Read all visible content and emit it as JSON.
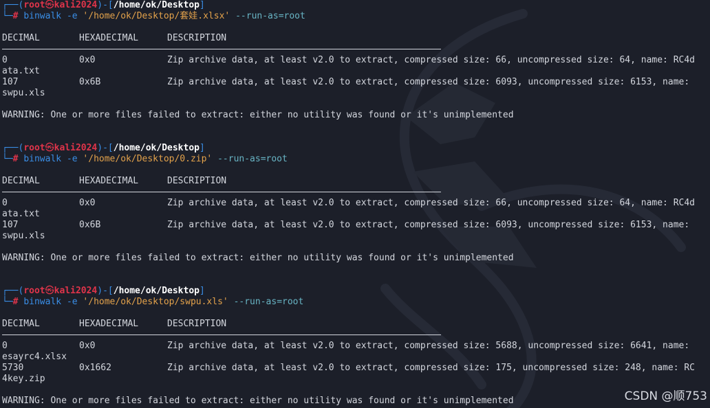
{
  "prompt_box_top": "┌──(",
  "prompt_box_mid": ")-[",
  "prompt_box_end": "]",
  "prompt_box_bottom": "└─",
  "prompt_user": "root",
  "prompt_at": "㉿",
  "prompt_host": "kali2024",
  "prompt_hash": "#",
  "blocks": [
    {
      "path": "/home/ok/Desktop",
      "cmd": "binwalk",
      "opt": "-e",
      "arg": "'/home/ok/Desktop/套娃.xlsx'",
      "flag": "--run-as=root",
      "headers": [
        "DECIMAL",
        "HEXADECIMAL",
        "DESCRIPTION"
      ],
      "rows": [
        {
          "dec": "0",
          "hex": "0x0",
          "desc": "Zip archive data, at least v2.0 to extract, compressed size: 66, uncompressed size: 64, name: RC4d",
          "wrap": "ata.txt"
        },
        {
          "dec": "107",
          "hex": "0x6B",
          "desc": "Zip archive data, at least v2.0 to extract, compressed size: 6093, uncompressed size: 6153, name:",
          "wrap": "swpu.xls"
        }
      ],
      "warning": "WARNING: One or more files failed to extract: either no utility was found or it's unimplemented"
    },
    {
      "path": "/home/ok/Desktop",
      "cmd": "binwalk",
      "opt": "-e",
      "arg": "'/home/ok/Desktop/0.zip'",
      "flag": "--run-as=root",
      "headers": [
        "DECIMAL",
        "HEXADECIMAL",
        "DESCRIPTION"
      ],
      "rows": [
        {
          "dec": "0",
          "hex": "0x0",
          "desc": "Zip archive data, at least v2.0 to extract, compressed size: 66, uncompressed size: 64, name: RC4d",
          "wrap": "ata.txt"
        },
        {
          "dec": "107",
          "hex": "0x6B",
          "desc": "Zip archive data, at least v2.0 to extract, compressed size: 6093, uncompressed size: 6153, name:",
          "wrap": "swpu.xls"
        }
      ],
      "warning": "WARNING: One or more files failed to extract: either no utility was found or it's unimplemented"
    },
    {
      "path": "/home/ok/Desktop",
      "cmd": "binwalk",
      "opt": "-e",
      "arg": "'/home/ok/Desktop/swpu.xls'",
      "flag": "--run-as=root",
      "headers": [
        "DECIMAL",
        "HEXADECIMAL",
        "DESCRIPTION"
      ],
      "rows": [
        {
          "dec": "0",
          "hex": "0x0",
          "desc": "Zip archive data, at least v2.0 to extract, compressed size: 5688, uncompressed size: 6641, name:",
          "wrap": "esayrc4.xlsx"
        },
        {
          "dec": "5730",
          "hex": "0x1662",
          "desc": "Zip archive data, at least v2.0 to extract, compressed size: 175, uncompressed size: 248, name: RC",
          "wrap": "4key.zip"
        }
      ],
      "warning": "WARNING: One or more files failed to extract: either no utility was found or it's unimplemented"
    }
  ],
  "watermark": "CSDN @顺753",
  "colors": {
    "background": "#1c1f29",
    "prompt_box": "#3a8ee6",
    "prompt_user": "#e0344a",
    "command": "#3a8ee6",
    "string": "#e3a24b",
    "flag": "#68b4c4",
    "text": "#d4d7de"
  }
}
